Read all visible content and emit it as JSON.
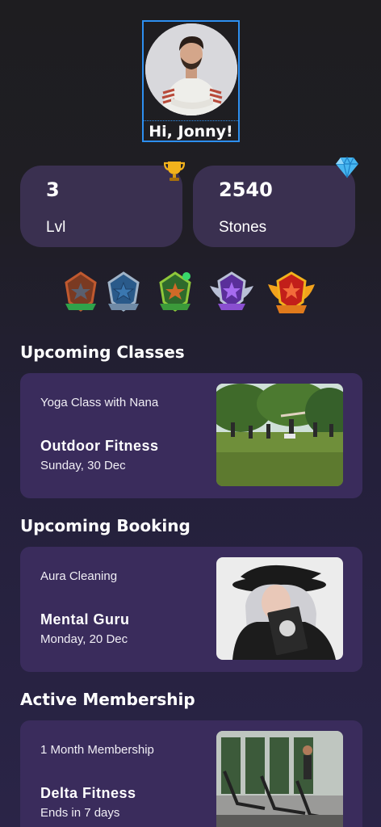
{
  "profile": {
    "greeting": "Hi, Jonny!"
  },
  "stats": [
    {
      "value": "3",
      "label": "Lvl",
      "icon": "trophy-icon"
    },
    {
      "value": "2540",
      "label": "Stones",
      "icon": "diamond-icon"
    }
  ],
  "badges": [
    {
      "name": "bronze-star-badge",
      "color": "#c0592f"
    },
    {
      "name": "silver-blue-star-badge",
      "color": "#3a77b0"
    },
    {
      "name": "green-star-badge",
      "color": "#d06a28"
    },
    {
      "name": "purple-winged-star-badge",
      "color": "#8a4fd0"
    },
    {
      "name": "gold-winged-star-badge",
      "color": "#d0301e"
    }
  ],
  "sections": {
    "classes": {
      "heading": "Upcoming Classes",
      "subtitle": "Yoga Class with Nana",
      "title": "Outdoor Fitness",
      "date": "Sunday, 30 Dec"
    },
    "booking": {
      "heading": "Upcoming Booking",
      "subtitle": "Aura Cleaning",
      "title": "Mental Guru",
      "date": "Monday, 20 Dec"
    },
    "membership": {
      "heading": "Active Membership",
      "subtitle": "1 Month Membership",
      "title": "Delta Fitness",
      "date": "Ends in 7 days"
    }
  },
  "colors": {
    "card": "#3a2c5c",
    "stat_card": "#3a3050",
    "selection_outline": "#2d8ff0",
    "online_dot": "#38d96b"
  }
}
